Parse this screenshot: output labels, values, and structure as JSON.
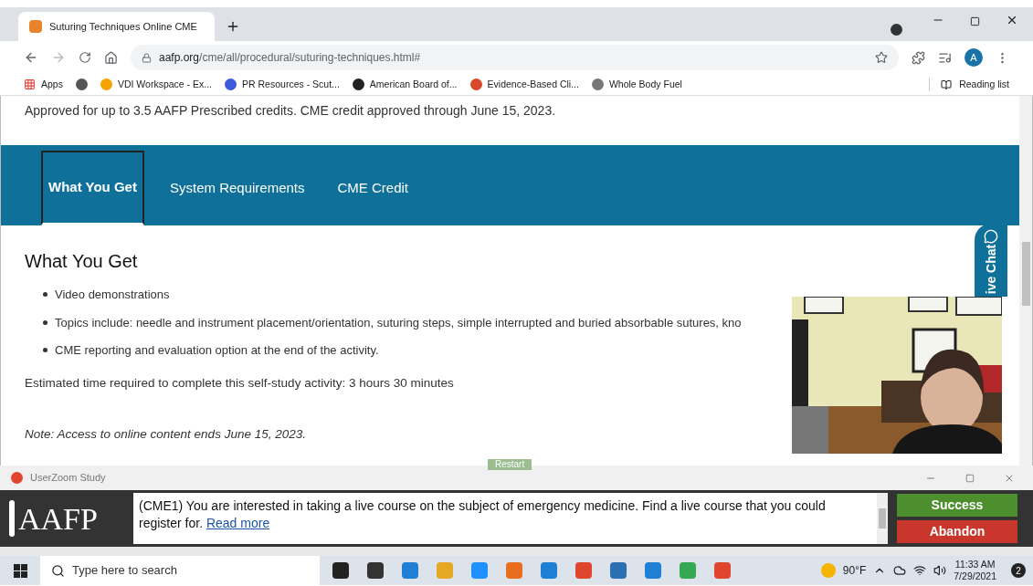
{
  "browser": {
    "tabs": [
      {
        "title": "Suturing Techniques Online CME",
        "selected": true
      }
    ],
    "url_host": "aafp.org",
    "url_path": "/cme/all/procedural/suturing-techniques.html#",
    "profile": "A",
    "bookmarks": [
      "Apps",
      "VDI Workspace - Ex...",
      "PR Resources - Scut...",
      "American Board of...",
      "Evidence-Based Cli...",
      "Whole Body Fuel"
    ],
    "reading_list": "Reading list"
  },
  "page": {
    "approved": "Approved for up to 3.5 AAFP Prescribed credits. CME credit approved through June 15, 2023.",
    "tabs": [
      {
        "label": "What You Get",
        "selected": true
      },
      {
        "label": "System Requirements",
        "selected": false
      },
      {
        "label": "CME Credit",
        "selected": false
      }
    ],
    "heading": "What You Get",
    "bullets": [
      "Video demonstrations",
      "Topics include: needle and instrument placement/orientation, suturing steps, simple interrupted and buried absorbable sutures, kno",
      "CME reporting and evaluation option at the end of the activity."
    ],
    "estimate": "Estimated time required to complete this self-study activity: 3 hours 30 minutes",
    "note": "Note: Access to online content ends June 15, 2023.",
    "live_chat": "ive Chat",
    "restart": "Restart"
  },
  "study": {
    "title": "UserZoom Study",
    "logo": "AAFP",
    "task": "(CME1) You are interested in taking a live course on the subject of emergency medicine. Find a live course that you could register for.",
    "read_more": "Read more",
    "success": "Success",
    "abandon": "Abandon"
  },
  "taskbar": {
    "search_placeholder": "Type here to search",
    "weather": "90°F",
    "time": "11:33 AM",
    "date": "7/29/2021",
    "notifications": "2"
  }
}
